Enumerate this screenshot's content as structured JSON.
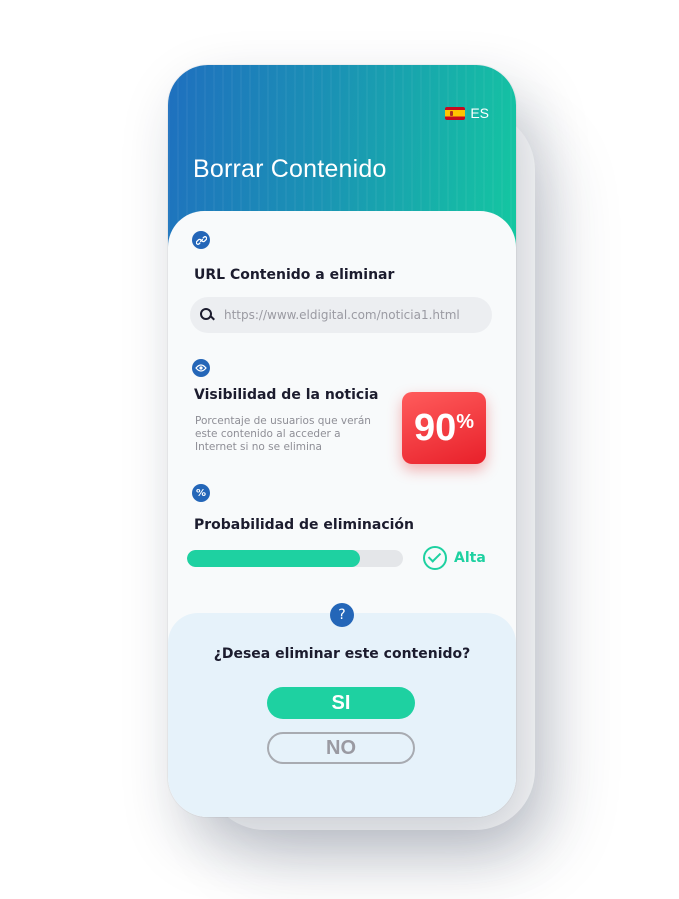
{
  "header": {
    "title": "Borrar Contenido",
    "language": "ES"
  },
  "url_section": {
    "label": "URL Contenido a eliminar",
    "input_placeholder": "https://www.eldigital.com/noticia1.html",
    "input_value": ""
  },
  "visibility_section": {
    "label": "Visibilidad de la noticia",
    "description": "Porcentaje de usuarios que verán este contenido al acceder a Internet si no se elimina",
    "percent_value": "90",
    "percent_sign": "%"
  },
  "probability_section": {
    "label": "Probabilidad de eliminación",
    "progress_fraction": 0.8,
    "status": "Alta"
  },
  "confirm": {
    "question": "¿Desea eliminar este contenido?",
    "yes_label": "SI",
    "no_label": "NO"
  },
  "colors": {
    "accent_green": "#1ed1a1",
    "primary_blue": "#2466b8",
    "alert_red": "#e8202a"
  },
  "icons": {
    "link": "link-icon",
    "eye": "eye-icon",
    "percent": "percent-icon",
    "question": "question-icon",
    "check": "check-circle-icon",
    "search": "search-icon",
    "flag": "spain-flag-icon"
  }
}
